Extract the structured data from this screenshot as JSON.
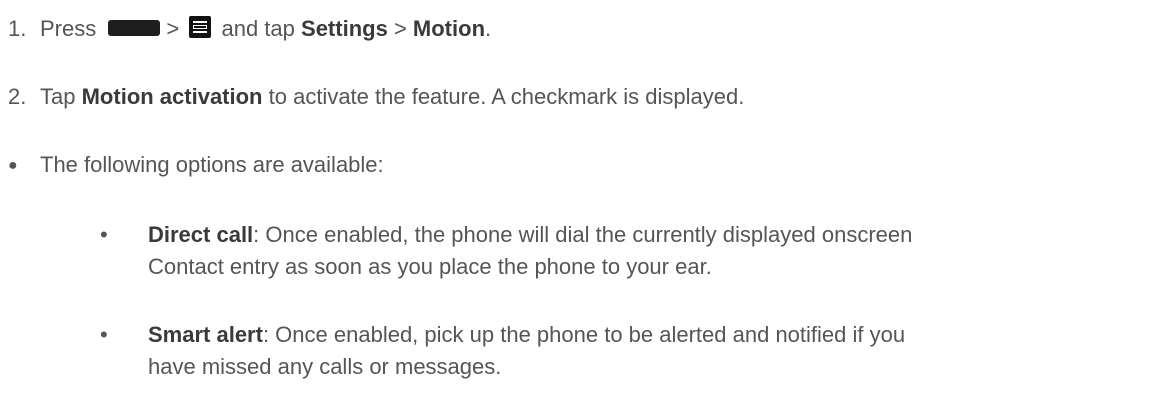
{
  "steps": [
    {
      "number": "1.",
      "press": "Press",
      "gt1": ">",
      "and_tap": "and tap",
      "settings": "Settings",
      "gt2": ">",
      "motion": "Motion",
      "period": "."
    },
    {
      "number": "2.",
      "tap": "Tap",
      "motion_activation": "Motion activation",
      "rest": "to activate the feature. A checkmark is displayed."
    }
  ],
  "bullet": {
    "marker": "●",
    "text": "The following options are available:"
  },
  "options": [
    {
      "marker": "•",
      "name": "Direct call",
      "line1": ": Once enabled, the phone will dial the currently displayed onscreen",
      "line2": "Contact entry as soon as you place the phone to your ear."
    },
    {
      "marker": "•",
      "name": "Smart alert",
      "line1": ": Once enabled, pick up the phone to be alerted and notified if you",
      "line2": "have missed any calls or messages."
    }
  ],
  "icons": {
    "home_key": "home-key-icon",
    "menu_key": "menu-key-icon"
  }
}
